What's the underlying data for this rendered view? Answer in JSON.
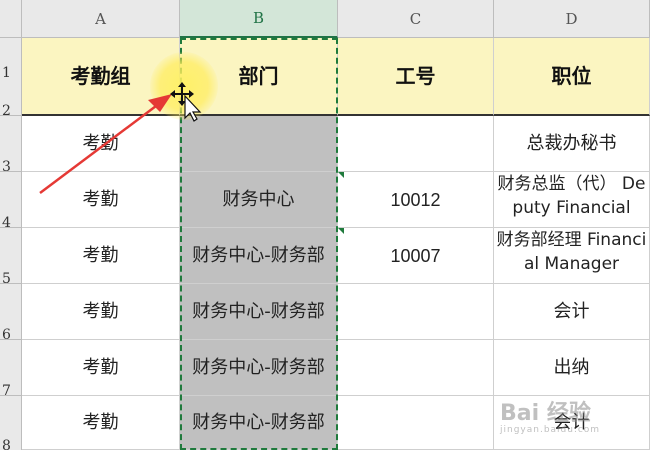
{
  "columns": [
    "A",
    "B",
    "C",
    "D"
  ],
  "rows": [
    "1",
    "2",
    "3",
    "4",
    "5",
    "6",
    "7",
    "8"
  ],
  "header": {
    "a": "考勤组",
    "b": "部门",
    "c": "工号",
    "d": "职位"
  },
  "records": [
    {
      "a": "考勤",
      "b": "",
      "c": "",
      "d": "总裁办秘书"
    },
    {
      "a": "考勤",
      "b": "财务中心",
      "c": "10012",
      "d": "财务总监（代） Deputy Financial"
    },
    {
      "a": "考勤",
      "b": "财务中心-财务部",
      "c": "10007",
      "d": "财务部经理 Financial Manager"
    },
    {
      "a": "考勤",
      "b": "财务中心-财务部",
      "c": "",
      "d": "会计"
    },
    {
      "a": "考勤",
      "b": "财务中心-财务部",
      "c": "",
      "d": "出纳"
    },
    {
      "a": "考勤",
      "b": "财务中心-财务部",
      "c": "",
      "d": "会计"
    }
  ],
  "watermark": {
    "main": "Bai 经验",
    "sub": "jingyan.baidu.com"
  },
  "colors": {
    "header_fill": "#fbf5c1",
    "selected_fill": "#c0c0c0",
    "selection_border": "#1f7a3c",
    "arrow": "#e53935"
  },
  "icons": {
    "cursor": "move-cursor-icon",
    "annotation": "red-arrow-icon"
  }
}
